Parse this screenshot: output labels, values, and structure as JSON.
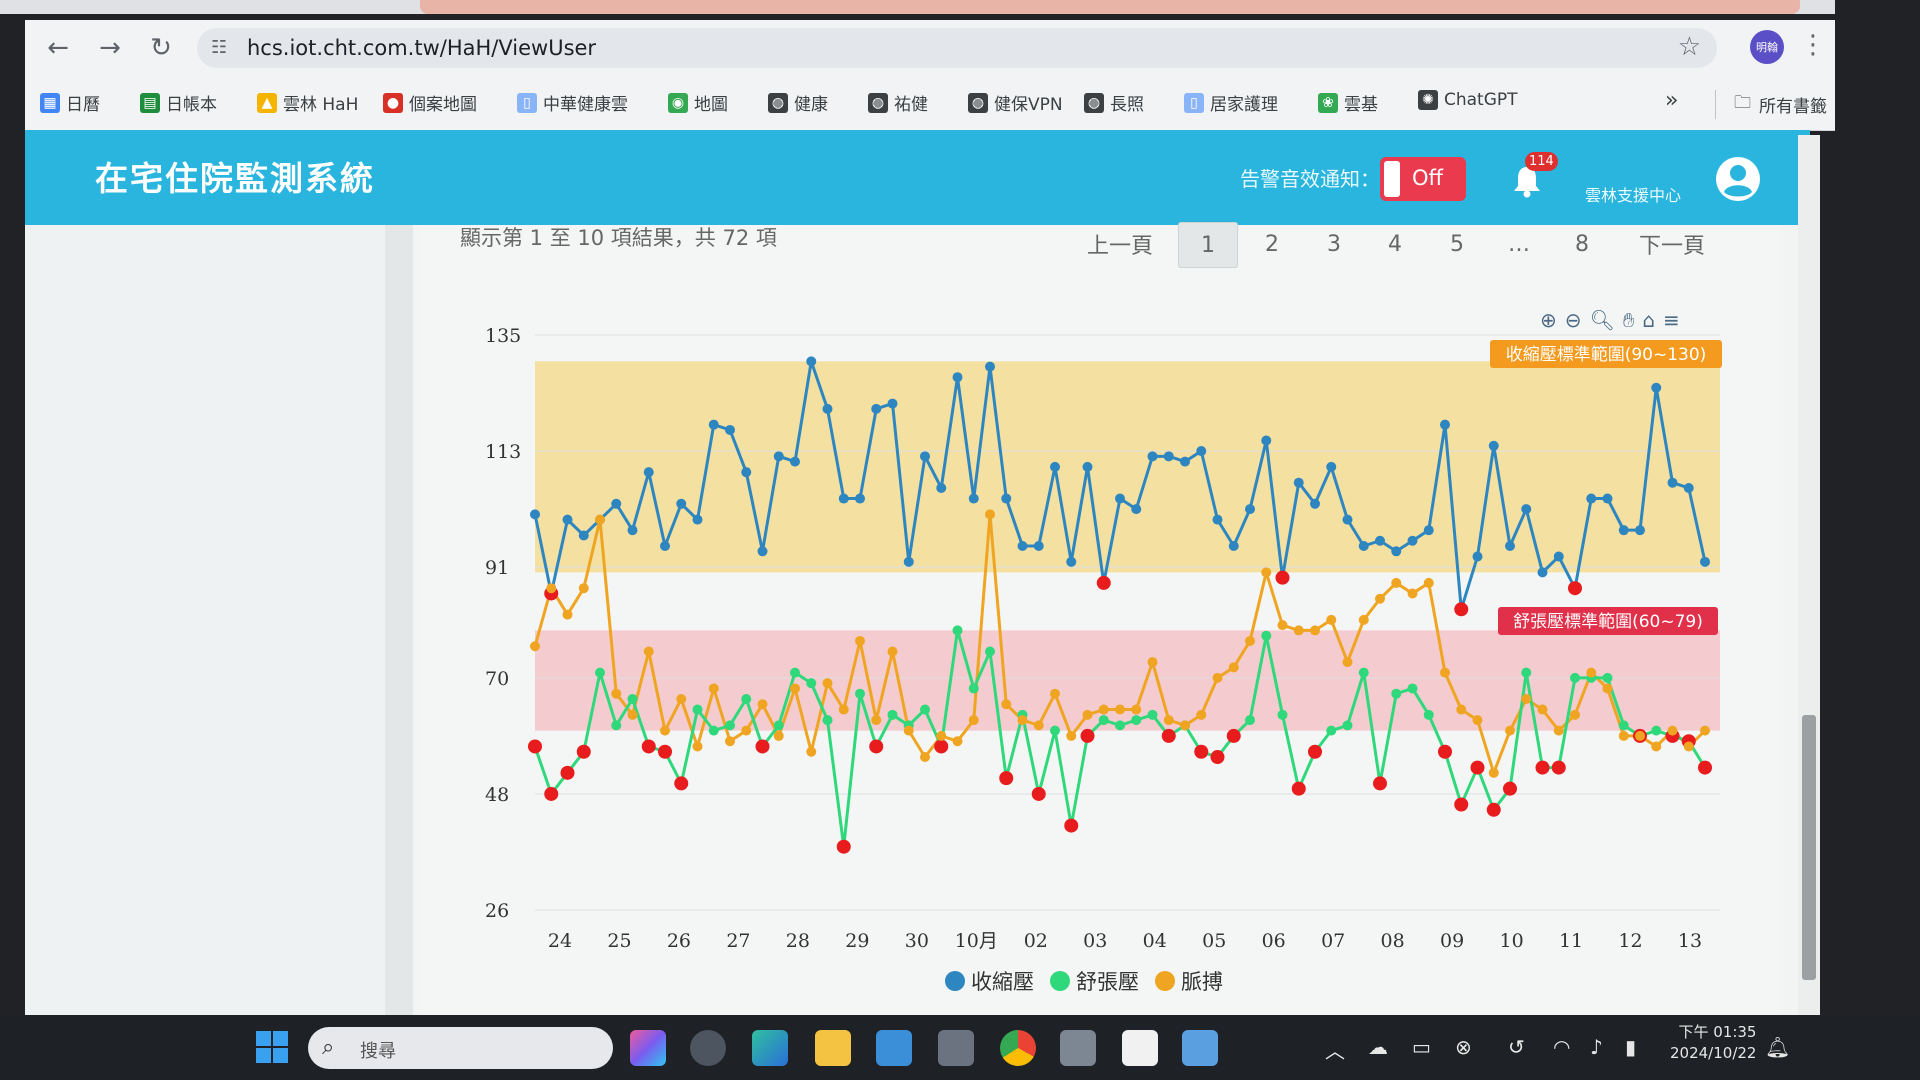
{
  "browser": {
    "url": "hcs.iot.cht.com.tw/HaH/ViewUser",
    "profile_label": "明翰",
    "bookmarks": [
      {
        "label": "日曆",
        "icon": "calendar-icon",
        "color": "#4285f4"
      },
      {
        "label": "日帳本",
        "icon": "sheets-icon",
        "color": "#1e8e3e"
      },
      {
        "label": "雲林 HaH",
        "icon": "drive-icon",
        "color": "#f4b400"
      },
      {
        "label": "個案地圖",
        "icon": "map-pin-icon",
        "color": "#d93025"
      },
      {
        "label": "中華健康雲",
        "icon": "doc-icon",
        "color": "#8ab4f8"
      },
      {
        "label": "地圖",
        "icon": "maps-icon",
        "color": "#34a853"
      },
      {
        "label": "健康",
        "icon": "globe-icon",
        "color": "#3c4043"
      },
      {
        "label": "祐健",
        "icon": "globe-icon",
        "color": "#3c4043"
      },
      {
        "label": "健保VPN",
        "icon": "globe-icon",
        "color": "#3c4043"
      },
      {
        "label": "長照",
        "icon": "globe-icon",
        "color": "#3c4043"
      },
      {
        "label": "居家護理",
        "icon": "doc-icon",
        "color": "#8ab4f8"
      },
      {
        "label": "雲基",
        "icon": "leaf-icon",
        "color": "#34a853"
      },
      {
        "label": "ChatGPT",
        "icon": "chatgpt-icon",
        "color": "#3c4043"
      }
    ],
    "bookmarks_more": "»",
    "all_bookmarks": "所有書籤"
  },
  "app": {
    "title": "在宅住院監測系統",
    "alarm_label": "告警音效通知：",
    "alarm_state": "Off",
    "notification_count": "114",
    "center_name": "雲林支援中心",
    "accent": "#2ab5de"
  },
  "table": {
    "result_info": "顯示第 1 至 10 項結果，共 72 項",
    "prev": "上一頁",
    "pages": [
      "1",
      "2",
      "3",
      "4",
      "5",
      "…",
      "8"
    ],
    "current_page": "1",
    "next": "下一頁"
  },
  "chart_data": {
    "type": "line",
    "x_tick_labels": [
      "24",
      "25",
      "26",
      "27",
      "28",
      "29",
      "30",
      "10月",
      "02",
      "03",
      "04",
      "05",
      "06",
      "07",
      "08",
      "09",
      "10",
      "11",
      "12",
      "13"
    ],
    "y_ticks": [
      26,
      48,
      70,
      91,
      113,
      135
    ],
    "ylim": [
      26,
      135
    ],
    "bands": [
      {
        "label": "收縮壓標準範圍(90~130)",
        "from": 90,
        "to": 130,
        "color": "#f3dc92",
        "label_color": "#f39a1f"
      },
      {
        "label": "舒張壓標準範圍(60~79)",
        "from": 60,
        "to": 79,
        "color": "#f3c3c8",
        "label_color": "#e0304a"
      }
    ],
    "series": [
      {
        "name": "收縮壓",
        "color": "#2e86c1",
        "values": [
          101,
          86,
          100,
          97,
          100,
          103,
          98,
          109,
          95,
          103,
          100,
          118,
          117,
          109,
          94,
          112,
          111,
          130,
          121,
          104,
          104,
          121,
          122,
          92,
          112,
          106,
          127,
          104,
          129,
          104,
          95,
          95,
          110,
          92,
          110,
          88,
          104,
          102,
          112,
          112,
          111,
          113,
          100,
          95,
          102,
          115,
          89,
          107,
          103,
          110,
          100,
          95,
          96,
          94,
          96,
          98,
          118,
          83,
          93,
          114,
          95,
          102,
          90,
          93,
          87,
          104,
          104,
          98,
          98,
          125,
          107,
          106,
          92
        ]
      },
      {
        "name": "舒張壓",
        "color": "#2fd87a",
        "values": [
          57,
          48,
          52,
          56,
          71,
          61,
          66,
          57,
          56,
          50,
          64,
          60,
          61,
          66,
          57,
          61,
          71,
          69,
          62,
          38,
          67,
          57,
          63,
          61,
          64,
          57,
          79,
          68,
          75,
          51,
          63,
          48,
          60,
          42,
          59,
          62,
          61,
          62,
          63,
          59,
          61,
          56,
          55,
          59,
          62,
          78,
          63,
          49,
          56,
          60,
          61,
          71,
          50,
          67,
          68,
          63,
          56,
          46,
          53,
          45,
          49,
          71,
          53,
          53,
          70,
          70,
          70,
          61,
          59,
          60,
          59,
          58,
          53
        ]
      },
      {
        "name": "脈搏",
        "color": "#f0a522",
        "values": [
          76,
          87,
          82,
          87,
          100,
          67,
          63,
          75,
          60,
          66,
          57,
          68,
          58,
          60,
          65,
          59,
          68,
          56,
          69,
          64,
          77,
          62,
          75,
          60,
          55,
          59,
          58,
          62,
          101,
          65,
          62,
          61,
          67,
          59,
          63,
          64,
          64,
          64,
          73,
          62,
          61,
          63,
          70,
          72,
          77,
          90,
          80,
          79,
          79,
          81,
          73,
          81,
          85,
          88,
          86,
          88,
          71,
          64,
          62,
          52,
          60,
          66,
          64,
          60,
          63,
          71,
          68,
          59,
          59,
          57,
          60,
          57,
          60
        ]
      }
    ],
    "alerts": {
      "systolic_below": 90,
      "diastolic_below": 60
    }
  },
  "legend": [
    "收縮壓",
    "舒張壓",
    "脈搏"
  ],
  "taskbar": {
    "search_placeholder": "搜尋",
    "time": "下午 01:35",
    "date": "2024/10/22",
    "notion_badge": "1"
  }
}
